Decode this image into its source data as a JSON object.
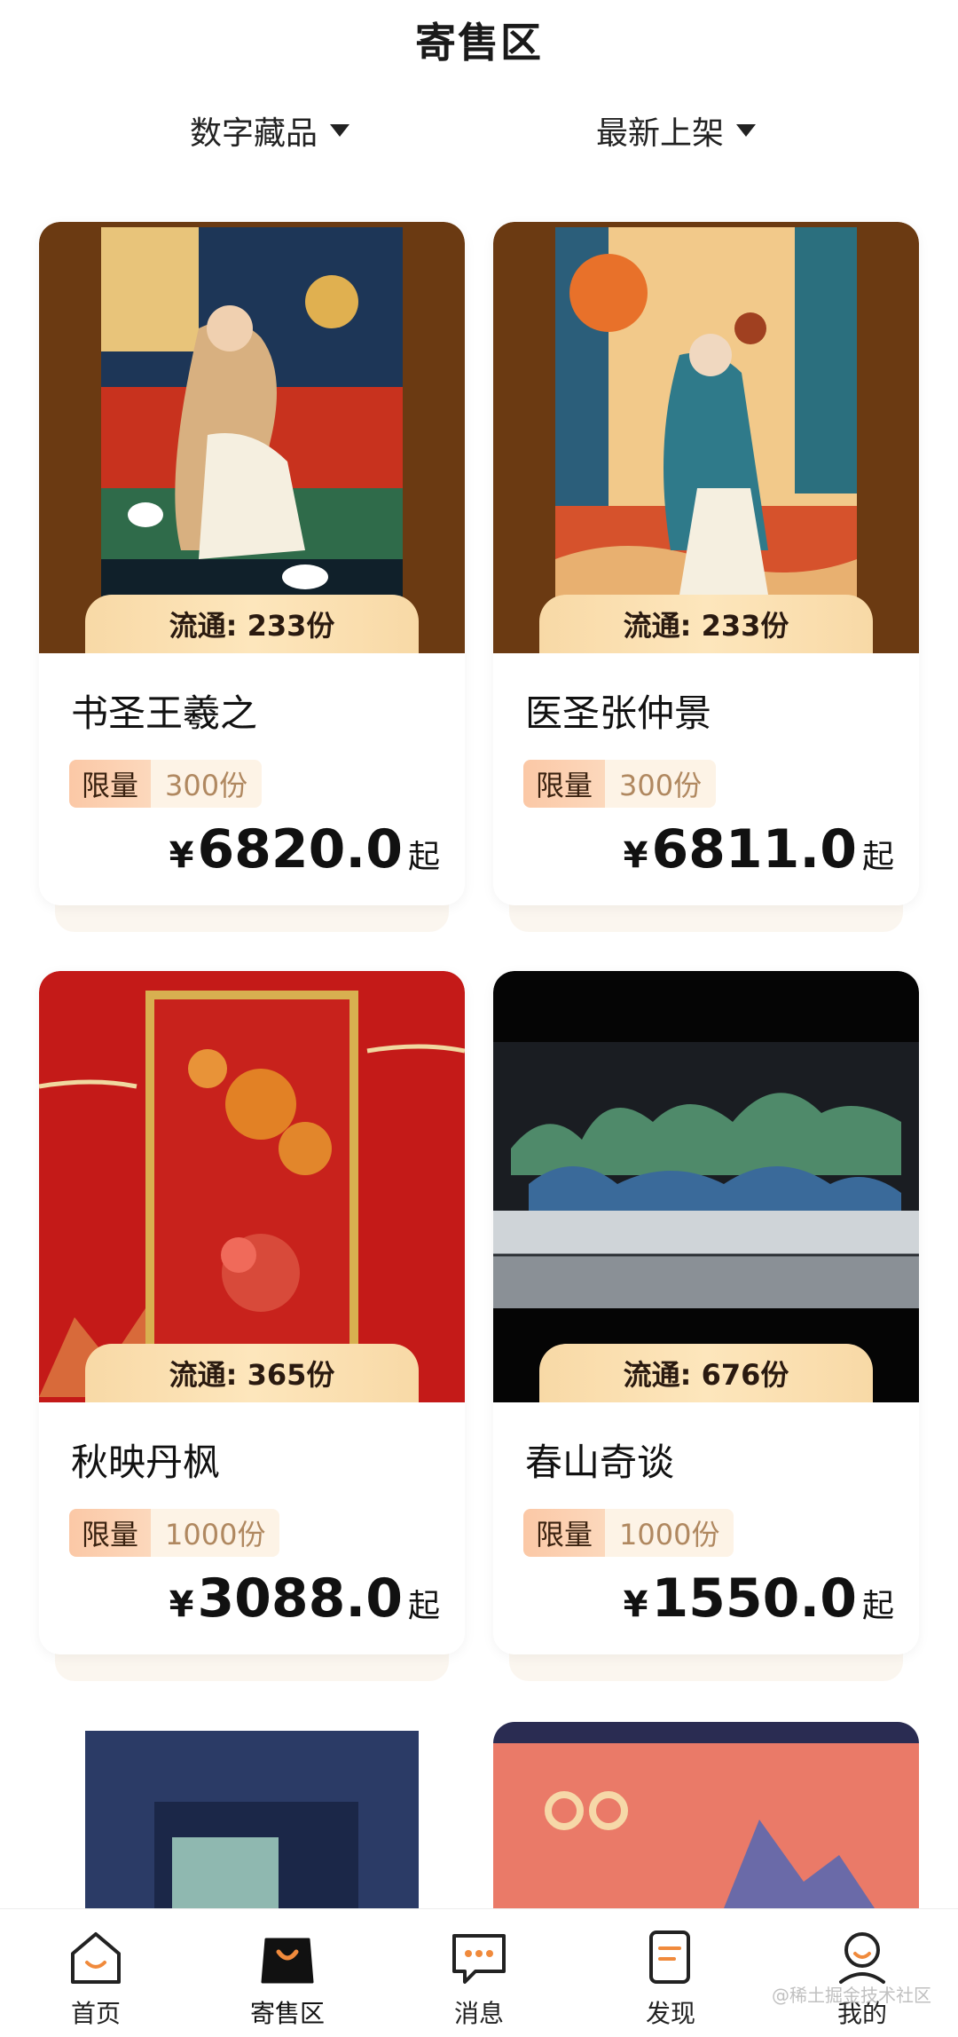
{
  "header": {
    "title": "寄售区"
  },
  "filters": {
    "category": "数字藏品",
    "sort": "最新上架"
  },
  "products": [
    {
      "name": "书圣王羲之",
      "circulation": "流通: 233份",
      "limit_tag": "限量",
      "limit_qty": "300份",
      "currency": "¥",
      "price": "6820.0",
      "suffix": "起"
    },
    {
      "name": "医圣张仲景",
      "circulation": "流通: 233份",
      "limit_tag": "限量",
      "limit_qty": "300份",
      "currency": "¥",
      "price": "6811.0",
      "suffix": "起"
    },
    {
      "name": "秋映丹枫",
      "circulation": "流通: 365份",
      "limit_tag": "限量",
      "limit_qty": "1000份",
      "currency": "¥",
      "price": "3088.0",
      "suffix": "起"
    },
    {
      "name": "春山奇谈",
      "circulation": "流通: 676份",
      "limit_tag": "限量",
      "limit_qty": "1000份",
      "currency": "¥",
      "price": "1550.0",
      "suffix": "起"
    }
  ],
  "tabbar": {
    "items": [
      {
        "label": "首页",
        "icon": "home-icon"
      },
      {
        "label": "寄售区",
        "icon": "shopping-bag-icon"
      },
      {
        "label": "消息",
        "icon": "message-icon"
      },
      {
        "label": "发现",
        "icon": "discover-icon"
      },
      {
        "label": "我的",
        "icon": "profile-icon"
      }
    ],
    "active": "寄售区"
  },
  "watermark": "@稀土掘金技术社区",
  "colors": {
    "accent": "#f08a3c",
    "price": "#111111",
    "limit_tag_bg": "#fbc8a6",
    "circulation_bg": "#fde6bc"
  }
}
